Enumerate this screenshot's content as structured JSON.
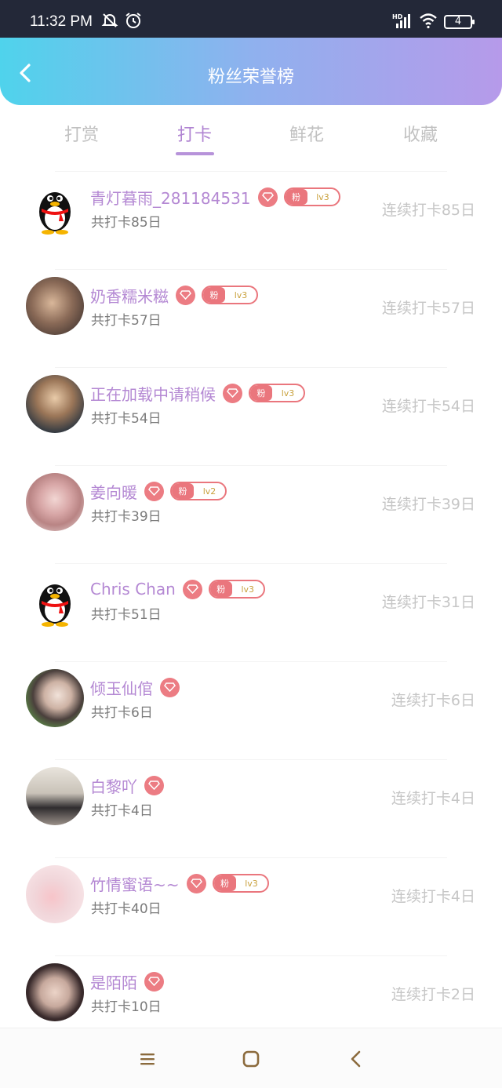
{
  "status_bar": {
    "time": "11:32 PM",
    "network": "HD",
    "battery": "4",
    "icons": [
      "bell-muted-icon",
      "alarm-icon",
      "signal-icon",
      "wifi-icon",
      "battery-icon"
    ]
  },
  "header": {
    "title": "粉丝荣誉榜",
    "gradient": [
      "#4fd3ec",
      "#b69aea"
    ]
  },
  "tabs": [
    {
      "label": "打赏",
      "active": false
    },
    {
      "label": "打卡",
      "active": true
    },
    {
      "label": "鲜花",
      "active": false
    },
    {
      "label": "收藏",
      "active": false
    }
  ],
  "rows": [
    {
      "name": "青灯暮雨_281184531",
      "fan": "粉",
      "level": "lv3",
      "total": "共打卡85日",
      "streak": "连续打卡85日",
      "avatar": "qq-penguin"
    },
    {
      "name": "奶香糯米糍",
      "fan": "粉",
      "level": "lv3",
      "total": "共打卡57日",
      "streak": "连续打卡57日",
      "avatar": "photo-boy"
    },
    {
      "name": "正在加载中请稍候",
      "fan": "粉",
      "level": "lv3",
      "total": "共打卡54日",
      "streak": "连续打卡54日",
      "avatar": "anime-boy"
    },
    {
      "name": "姜向暖",
      "fan": "粉",
      "level": "lv2",
      "total": "共打卡39日",
      "streak": "连续打卡39日",
      "avatar": "photo-girl-pink"
    },
    {
      "name": "Chris Chan",
      "fan": "粉",
      "level": "lv3",
      "total": "共打卡51日",
      "streak": "连续打卡31日",
      "avatar": "qq-penguin"
    },
    {
      "name": "倾玉仙倌",
      "fan": "",
      "level": "",
      "total": "共打卡6日",
      "streak": "连续打卡6日",
      "avatar": "photo-costume"
    },
    {
      "name": "白黎吖",
      "fan": "",
      "level": "",
      "total": "共打卡4日",
      "streak": "连续打卡4日",
      "avatar": "photo-standing"
    },
    {
      "name": "竹情蜜语~~",
      "fan": "粉",
      "level": "lv3",
      "total": "共打卡40日",
      "streak": "连续打卡4日",
      "avatar": "photo-hand-pink"
    },
    {
      "name": "是陌陌",
      "fan": "",
      "level": "",
      "total": "共打卡10日",
      "streak": "连续打卡2日",
      "avatar": "photo-doll"
    }
  ],
  "colors": {
    "name": "#b488d3",
    "diamond": "#ec7c83",
    "badge": "#ea767d",
    "tab_active": "#b084d2"
  }
}
